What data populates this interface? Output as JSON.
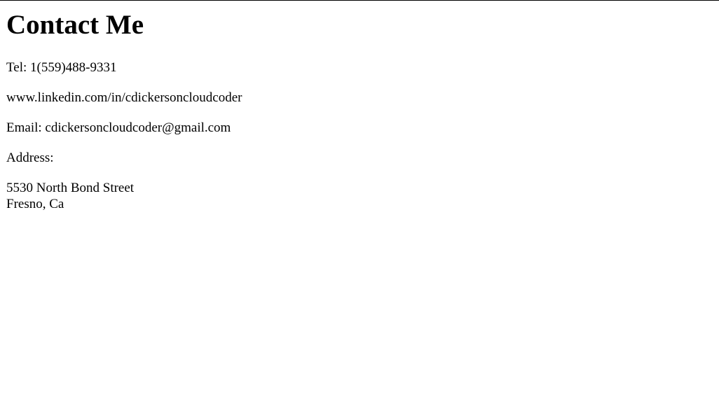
{
  "page": {
    "title": "Contact Me"
  },
  "contact": {
    "tel": "Tel: 1(559)488-9331",
    "linkedin": "www.linkedin.com/in/cdickersoncloudcoder",
    "email": "Email: cdickersoncloudcoder@gmail.com",
    "address_label": "Address:",
    "address_street": "5530 North Bond Street",
    "address_city": "Fresno, Ca"
  }
}
